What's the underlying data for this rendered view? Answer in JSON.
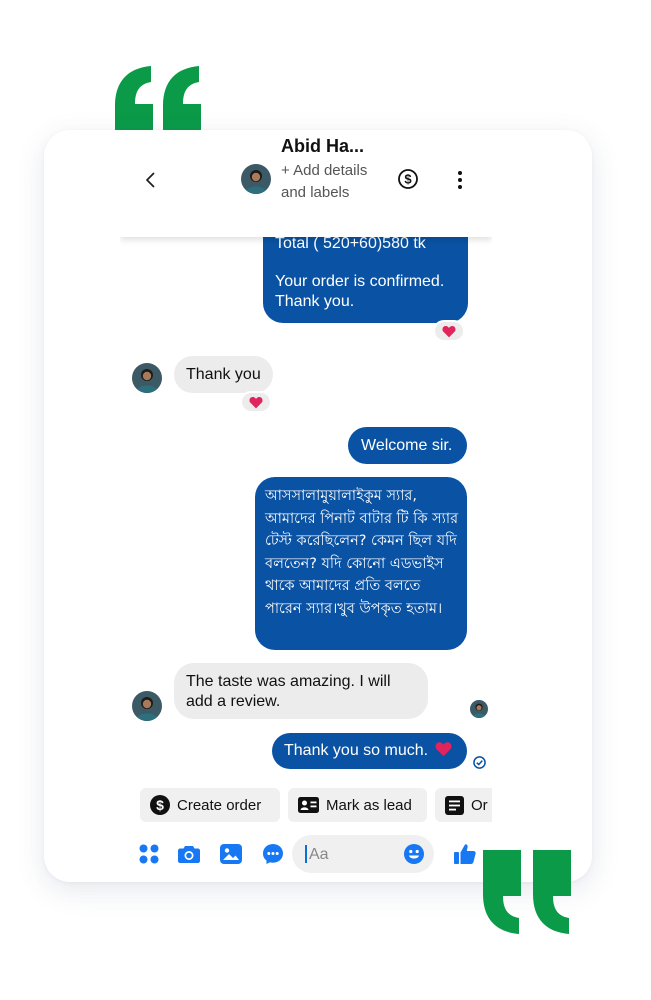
{
  "colors": {
    "accent": "#0a52a3",
    "brand_green": "#0a9a48",
    "icon_blue": "#1877f2",
    "heart": "#e0245e"
  },
  "header": {
    "contact_name": "Abid Ha...",
    "subtitle": "+ Add details and labels",
    "icons": [
      "chevron-left-icon",
      "dollar-circle-icon",
      "more-vertical-icon"
    ]
  },
  "messages": [
    {
      "from": "me",
      "line1": "Total ( 520+60)580 tk",
      "line2": "Your order is confirmed. Thank you.",
      "reaction": "heart"
    },
    {
      "from": "them",
      "text": "Thank you",
      "reaction": "heart"
    },
    {
      "from": "me",
      "text": "Welcome sir."
    },
    {
      "from": "me",
      "text": "আসসালামুয়ালাইকুম স্যার, আমাদের পিনাট বাটার টি কি স্যার টেস্ট করেছিলেন? কেমন ছিল যদি বলতেন? যদি কোনো এডভাইস থাকে আমাদের প্রতি বলতে পারেন স্যার।খুব উপকৃত হতাম।"
    },
    {
      "from": "them",
      "text": "The taste was amazing. I will add a review."
    },
    {
      "from": "me",
      "text": "Thank you so much.",
      "emoji": "heart"
    }
  ],
  "quick_actions": [
    {
      "label": "Create order",
      "icon": "dollar-circle-icon"
    },
    {
      "label": "Mark as lead",
      "icon": "contact-card-icon"
    },
    {
      "label": "Or",
      "icon": "document-icon"
    }
  ],
  "composer": {
    "placeholder": "Aa",
    "icons": [
      "apps-icon",
      "camera-icon",
      "image-icon",
      "messenger-icon",
      "emoji-icon",
      "thumbs-up-icon"
    ]
  }
}
